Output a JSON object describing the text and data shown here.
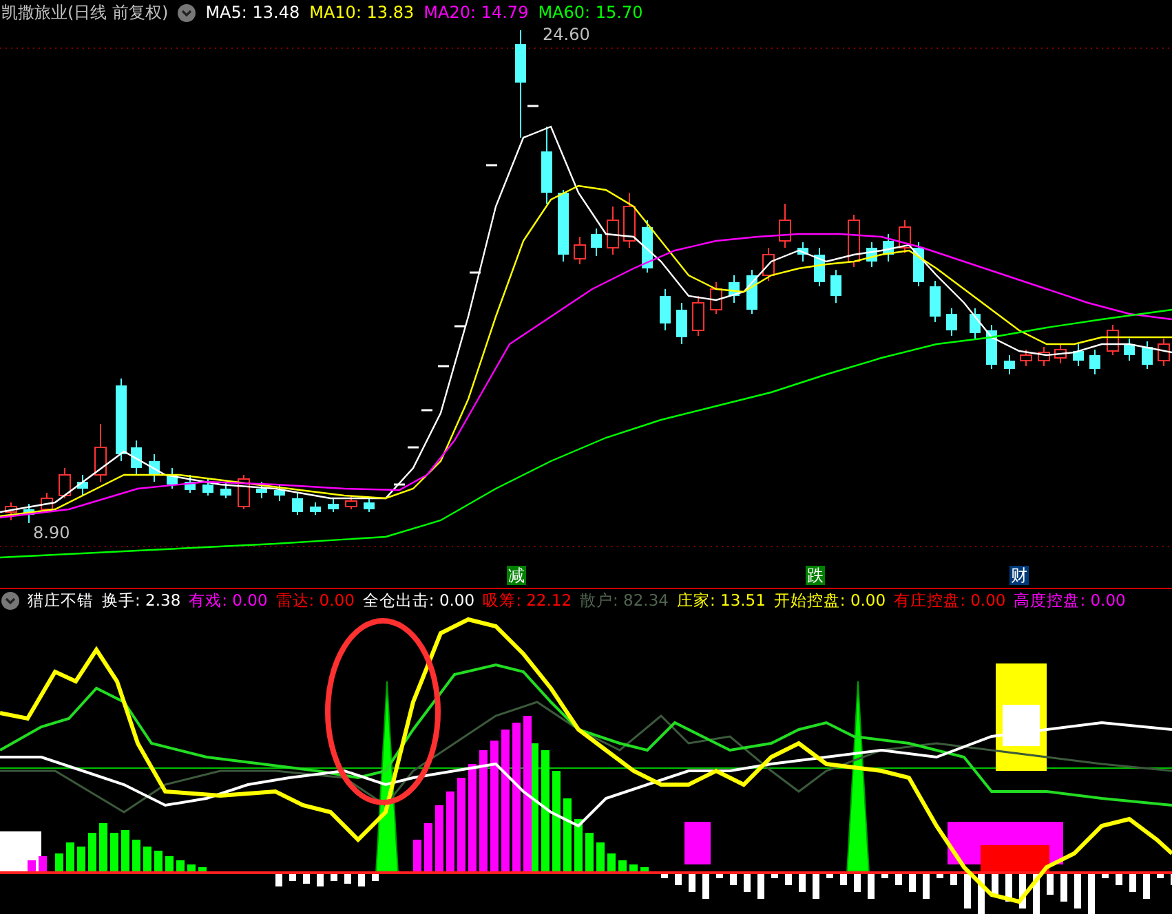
{
  "price_chart": {
    "title": "凯撒旅业(日线 前复权)",
    "ma_legend": [
      {
        "label": "MA5:",
        "value": "13.48",
        "color": "#ffffff"
      },
      {
        "label": "MA10:",
        "value": "13.83",
        "color": "#ffff00"
      },
      {
        "label": "MA20:",
        "value": "14.79",
        "color": "#ff00ff"
      },
      {
        "label": "MA60:",
        "value": "15.70",
        "color": "#00ff00"
      }
    ],
    "high_label": "24.60",
    "low_label": "8.90",
    "markers": [
      {
        "text": "减",
        "color": "#008000"
      },
      {
        "text": "跌",
        "color": "#008000"
      },
      {
        "text": "财",
        "color": "#003a7a"
      }
    ]
  },
  "indicator": {
    "name": "猎庄不错",
    "items": [
      {
        "label": "换手:",
        "value": "2.38",
        "color": "#ffffff"
      },
      {
        "label": "有戏:",
        "value": "0.00",
        "color": "#ff00ff"
      },
      {
        "label": "雷达:",
        "value": "0.00",
        "color": "#ff0000"
      },
      {
        "label": "全仓出击:",
        "value": "0.00",
        "color": "#ffffff"
      },
      {
        "label": "吸筹:",
        "value": "22.12",
        "color": "#ff0000"
      },
      {
        "label": "散户:",
        "value": "82.34",
        "color": "#506450"
      },
      {
        "label": "庄家:",
        "value": "13.51",
        "color": "#ffff00"
      },
      {
        "label": "开始控盘:",
        "value": "0.00",
        "color": "#ffff00"
      },
      {
        "label": "有庄控盘:",
        "value": "0.00",
        "color": "#ff0000"
      },
      {
        "label": "高度控盘:",
        "value": "0.00",
        "color": "#ff00ff"
      }
    ]
  }
}
